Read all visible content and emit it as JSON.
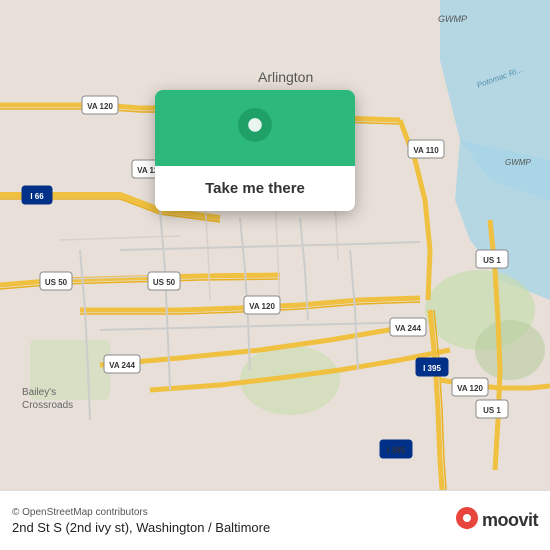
{
  "map": {
    "attribution": "© OpenStreetMap contributors"
  },
  "popup": {
    "button_label": "Take me there"
  },
  "bottom_bar": {
    "attribution": "© OpenStreetMap contributors",
    "address": "2nd St S (2nd ivy st), Washington / Baltimore"
  },
  "moovit": {
    "logo_text": "moovit"
  },
  "icons": {
    "location_pin": "📍",
    "moovit_pin": "📍"
  }
}
